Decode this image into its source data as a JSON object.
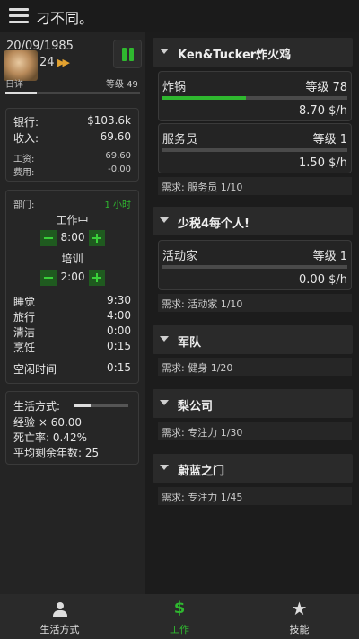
{
  "app": {
    "title": "刁不同。"
  },
  "character": {
    "date": "20/09/1985",
    "age": "24",
    "name_caption": "日详",
    "level_label": "等级 49",
    "xp_fraction": 0.23
  },
  "finance": {
    "bank_label": "银行:",
    "bank_value": "$103.6k",
    "income_label": "收入:",
    "income_value": "69.60",
    "wage_label": "工资:",
    "wage_value": "69.60",
    "expense_label": "费用:",
    "expense_value": "-0.00"
  },
  "department": {
    "label": "部门:",
    "period": "1 小时",
    "working_label": "工作中",
    "working_hours": "8:00",
    "training_label": "培训",
    "training_hours": "2:00",
    "schedule": [
      {
        "label": "睡觉",
        "value": "9:30"
      },
      {
        "label": "旅行",
        "value": "4:00"
      },
      {
        "label": "清洁",
        "value": "0:00"
      },
      {
        "label": "烹饪",
        "value": "0:15"
      }
    ],
    "free_time_label": "空闲时间",
    "free_time_value": "0:15"
  },
  "lifestyle": {
    "label": "生活方式:",
    "bar_fraction": 0.3,
    "xp_mult": "经验 × 60.00",
    "death_rate": "死亡率: 0.42%",
    "avg_years": "平均剩余年数: 25"
  },
  "sections": {
    "s1": {
      "title": "Ken&Tucker炸火鸡",
      "job1": {
        "name": "炸锅",
        "level": "等级 78",
        "progress": 0.45,
        "pay": "8.70 $/h"
      },
      "job2": {
        "name": "服务员",
        "level": "等级 1",
        "progress": 0.0,
        "pay": "1.50 $/h"
      },
      "req": "需求: 服务员 1/10"
    },
    "s2": {
      "title": "少税4每个人!",
      "job1": {
        "name": "活动家",
        "level": "等级 1",
        "progress": 0.0,
        "pay": "0.00 $/h"
      },
      "req": "需求: 活动家 1/10"
    },
    "s3": {
      "title": "军队",
      "req": "需求: 健身 1/20"
    },
    "s4": {
      "title": "梨公司",
      "req": "需求: 专注力 1/30"
    },
    "s5": {
      "title": "蔚蓝之门",
      "req": "需求: 专注力 1/45"
    }
  },
  "nav": {
    "lifestyle": "生活方式",
    "work": "工作",
    "skills": "技能"
  },
  "colors": {
    "accent": "#2fb82f",
    "fast_forward": "#e3a230"
  }
}
